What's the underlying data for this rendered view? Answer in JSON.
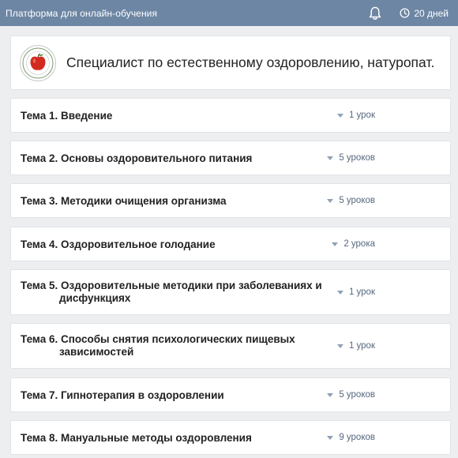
{
  "header": {
    "app_title": "Платформа для онлайн-обучения",
    "days_left": "20 дней"
  },
  "course": {
    "title": "Специалист по естественному оздоровлению, натуропат."
  },
  "topics": [
    {
      "line1": "Тема 1. Введение",
      "line2": "",
      "lessons": "1 урок"
    },
    {
      "line1": "Тема 2. Основы оздоровительного питания",
      "line2": "",
      "lessons": "5 уроков"
    },
    {
      "line1": "Тема 3. Методики очищения организма",
      "line2": "",
      "lessons": "5 уроков"
    },
    {
      "line1": "Тема 4. Оздоровительное голодание",
      "line2": "",
      "lessons": "2 урока"
    },
    {
      "line1": "Тема 5. Оздоровительные методики при заболеваниях и",
      "line2": "дисфункциях",
      "lessons": "1 урок"
    },
    {
      "line1": "Тема 6. Способы снятия психологических пищевых",
      "line2": "зависимостей",
      "lessons": "1 урок"
    },
    {
      "line1": "Тема 7. Гипнотерапия в оздоровлении",
      "line2": "",
      "lessons": "5 уроков"
    },
    {
      "line1": "Тема 8. Мануальные методы оздоровления",
      "line2": "",
      "lessons": "9 уроков"
    }
  ],
  "colors": {
    "header_bg": "#6d86a4",
    "page_bg": "#edeef0",
    "lesson_count": "#55677d"
  },
  "icons": {
    "bell": "bell-icon",
    "clock": "clock-icon",
    "expand": "caret-down-icon",
    "logo": "apple-logo"
  }
}
